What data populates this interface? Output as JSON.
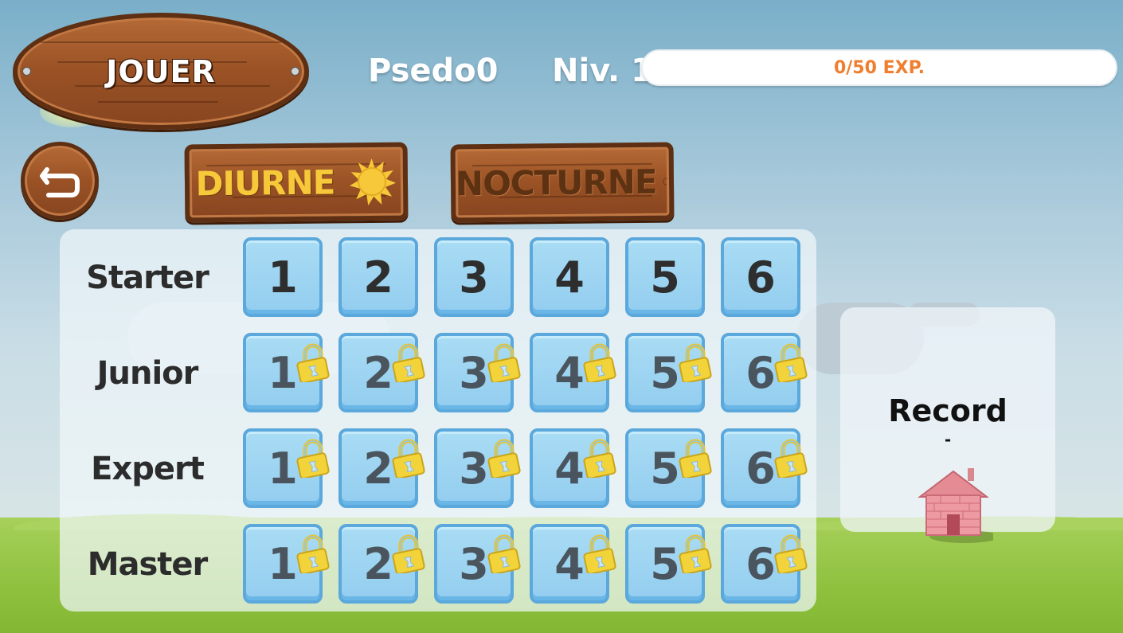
{
  "header": {
    "play_label": "JOUER",
    "player_name": "Psedo0",
    "level_label": "Niv. 1",
    "exp": {
      "text": "0/50 EXP.",
      "current": 0,
      "max": 50
    }
  },
  "navigation": {
    "back_icon": "back-arrow-icon"
  },
  "modes": [
    {
      "label": "DIURNE",
      "icon": "sun-icon",
      "active": true
    },
    {
      "label": "NOCTURNE",
      "icon": "moon-icon",
      "active": false
    }
  ],
  "difficulties": [
    {
      "label": "Starter",
      "levels": [
        {
          "num": "1",
          "locked": false
        },
        {
          "num": "2",
          "locked": false
        },
        {
          "num": "3",
          "locked": false
        },
        {
          "num": "4",
          "locked": false
        },
        {
          "num": "5",
          "locked": false
        },
        {
          "num": "6",
          "locked": false
        }
      ]
    },
    {
      "label": "Junior",
      "levels": [
        {
          "num": "1",
          "locked": true
        },
        {
          "num": "2",
          "locked": true
        },
        {
          "num": "3",
          "locked": true
        },
        {
          "num": "4",
          "locked": true
        },
        {
          "num": "5",
          "locked": true
        },
        {
          "num": "6",
          "locked": true
        }
      ]
    },
    {
      "label": "Expert",
      "levels": [
        {
          "num": "1",
          "locked": true
        },
        {
          "num": "2",
          "locked": true
        },
        {
          "num": "3",
          "locked": true
        },
        {
          "num": "4",
          "locked": true
        },
        {
          "num": "5",
          "locked": true
        },
        {
          "num": "6",
          "locked": true
        }
      ]
    },
    {
      "label": "Master",
      "levels": [
        {
          "num": "1",
          "locked": true
        },
        {
          "num": "2",
          "locked": true
        },
        {
          "num": "3",
          "locked": true
        },
        {
          "num": "4",
          "locked": true
        },
        {
          "num": "5",
          "locked": true
        },
        {
          "num": "6",
          "locked": true
        }
      ]
    }
  ],
  "record": {
    "label": "Record",
    "value": "-",
    "icon": "brick-house-icon"
  },
  "colors": {
    "accent_orange": "#ef7f2f",
    "tile_blue": "#93cdef",
    "wood": "#9a5225",
    "sun_yellow": "#f6c83a"
  }
}
